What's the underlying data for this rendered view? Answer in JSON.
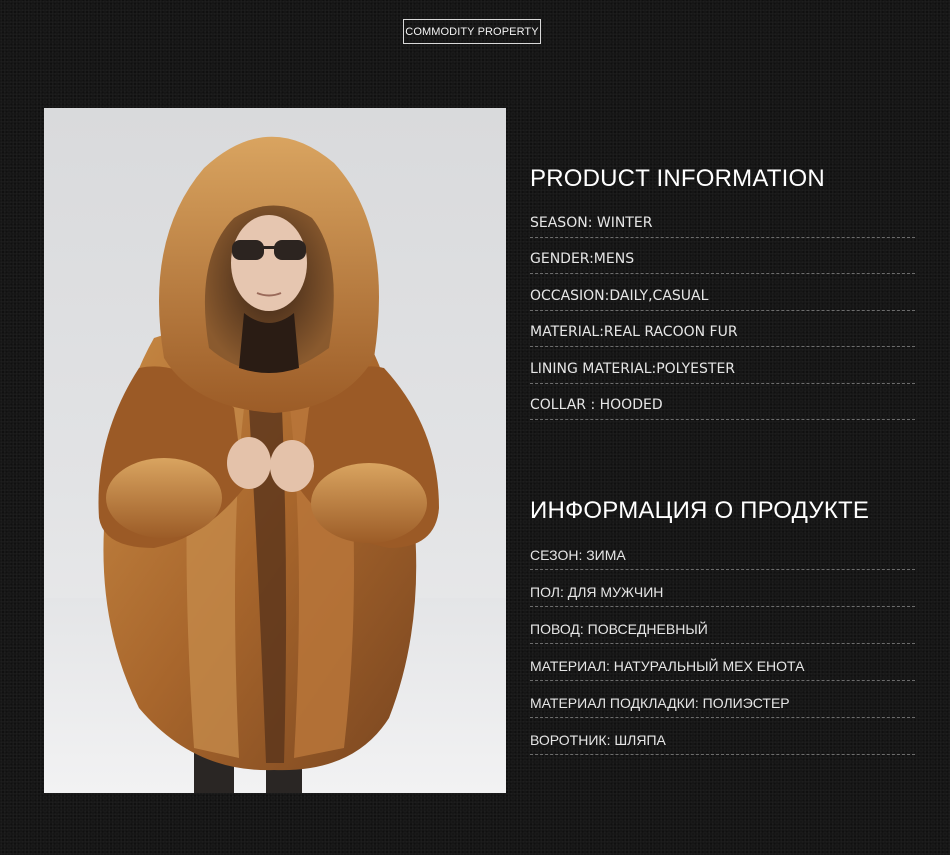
{
  "header": {
    "badge_label": "COMMODITY PROPERTY"
  },
  "product_info_en": {
    "title": "PRODUCT INFORMATION",
    "rows": [
      "SEASON:  WINTER",
      "GENDER:MENS",
      "OCCASION:DAILY,CASUAL",
      "MATERIAL:REAL RACOON FUR",
      "LINING MATERIAL:POLYESTER",
      "COLLAR : HOODED"
    ]
  },
  "product_info_ru": {
    "title": "ИНФОРМАЦИЯ О ПРОДУКТЕ",
    "rows": [
      "СЕЗОН: ЗИМА",
      "ПОЛ:  ДЛЯ МУЖЧИН",
      "ПОВОД: ПОВСЕДНЕВНЫЙ",
      "МАТЕРИАЛ: НАТУРАЛЬНЫЙ МЕХ ЕНОТА",
      "МАТЕРИАЛ ПОДКЛАДКИ:  ПОЛИЭСТЕР",
      "ВОРОТНИК: ШЛЯПА"
    ]
  },
  "colors": {
    "background": "#161616",
    "text": "#e6e6e6",
    "fur_light": "#d49a52",
    "fur_dark": "#6a3d1c"
  }
}
